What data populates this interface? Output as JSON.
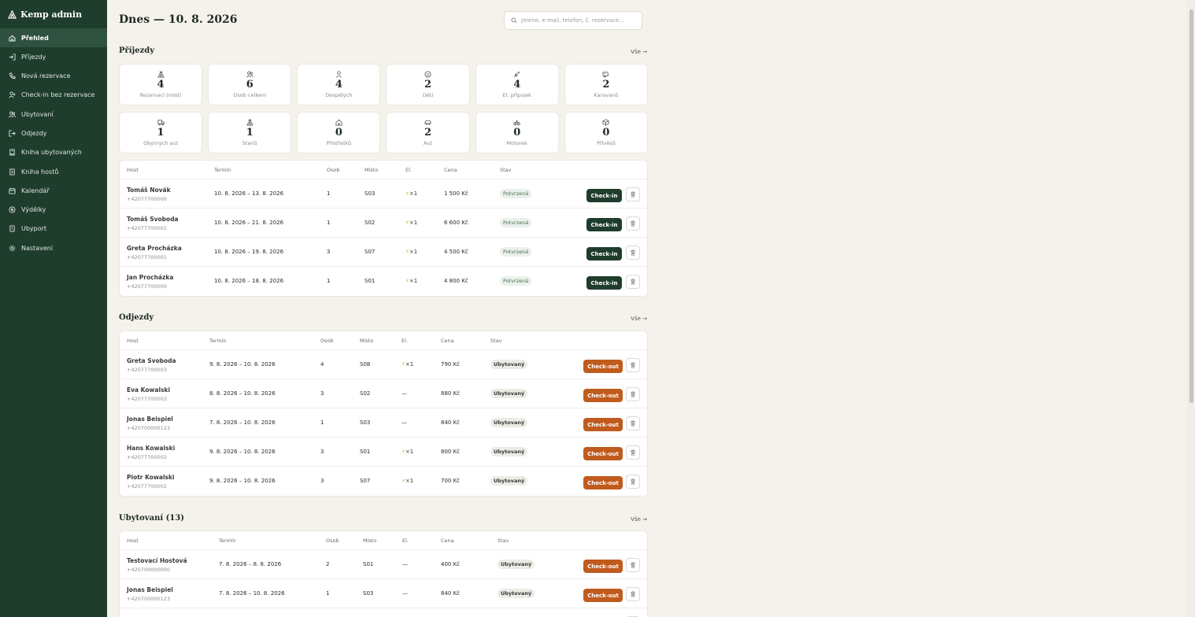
{
  "app": {
    "title": "Kemp admin"
  },
  "sidebar": {
    "items": [
      {
        "label": "Přehled",
        "icon": "home-icon",
        "active": true
      },
      {
        "label": "Příjezdy",
        "icon": "login-icon"
      },
      {
        "label": "Nová rezervace",
        "icon": "phone-icon"
      },
      {
        "label": "Check-in bez rezervace",
        "icon": "user-plus-icon"
      },
      {
        "label": "Ubytovaní",
        "icon": "users-icon"
      },
      {
        "label": "Odjezdy",
        "icon": "logout-icon"
      },
      {
        "label": "Kniha ubytovaných",
        "icon": "book-icon"
      },
      {
        "label": "Kniha hostů",
        "icon": "book-open-icon"
      },
      {
        "label": "Kalendář",
        "icon": "calendar-icon"
      },
      {
        "label": "Výdělky",
        "icon": "money-icon"
      },
      {
        "label": "Ubyport",
        "icon": "document-icon"
      },
      {
        "label": "Nastavení",
        "icon": "gear-icon"
      }
    ]
  },
  "header": {
    "title": "Dnes — 10. 8. 2026",
    "search_placeholder": "Jméno, e-mail, telefon, č. rezervace..."
  },
  "arrivals": {
    "title": "Příjezdy",
    "see_all": "Vše →",
    "stats": [
      {
        "value": "4",
        "label": "Rezervací (míst)",
        "icon": "tent-icon"
      },
      {
        "value": "6",
        "label": "Osob celkem",
        "icon": "users-icon"
      },
      {
        "value": "4",
        "label": "Dospělých",
        "icon": "person-icon"
      },
      {
        "value": "2",
        "label": "Děti",
        "icon": "child-icon"
      },
      {
        "value": "4",
        "label": "El. přípojek",
        "icon": "plug-icon"
      },
      {
        "value": "2",
        "label": "Karavanů",
        "icon": "caravan-icon"
      },
      {
        "value": "1",
        "label": "Obytných aut",
        "icon": "truck-icon"
      },
      {
        "value": "1",
        "label": "Stanů",
        "icon": "tent-icon"
      },
      {
        "value": "0",
        "label": "Přístřešků",
        "icon": "shelter-icon"
      },
      {
        "value": "2",
        "label": "Aut",
        "icon": "car-icon"
      },
      {
        "value": "0",
        "label": "Motorek",
        "icon": "bike-icon"
      },
      {
        "value": "0",
        "label": "Přívěsů",
        "icon": "box-icon"
      }
    ],
    "columns": [
      "Host",
      "Termín",
      "Osob",
      "Místo",
      "El.",
      "Cena",
      "Stav"
    ],
    "rows": [
      {
        "name": "Tomáš Novák",
        "phone": "+42077700000",
        "term": "10. 8. 2026 – 13. 8. 2026",
        "persons": "1",
        "place": "S03",
        "el": "×1",
        "price": "1 500 Kč",
        "status": "Potvrzená",
        "action": "Check-in"
      },
      {
        "name": "Tomáš Svoboda",
        "phone": "+42077700001",
        "term": "10. 8. 2026 – 21. 8. 2026",
        "persons": "1",
        "place": "S02",
        "el": "×1",
        "price": "6 600 Kč",
        "status": "Potvrzená",
        "action": "Check-in"
      },
      {
        "name": "Greta Procházka",
        "phone": "+42077700001",
        "term": "10. 8. 2026 – 19. 8. 2026",
        "persons": "3",
        "place": "S07",
        "el": "×1",
        "price": "4 500 Kč",
        "status": "Potvrzená",
        "action": "Check-in"
      },
      {
        "name": "Jan Procházka",
        "phone": "+42077700000",
        "term": "10. 8. 2026 – 18. 8. 2026",
        "persons": "1",
        "place": "S01",
        "el": "×1",
        "price": "4 800 Kč",
        "status": "Potvrzená",
        "action": "Check-in"
      }
    ]
  },
  "departures": {
    "title": "Odjezdy",
    "see_all": "Vše →",
    "columns": [
      "Host",
      "Termín",
      "Osob",
      "Místo",
      "El.",
      "Cena",
      "Stav"
    ],
    "rows": [
      {
        "name": "Greta Svoboda",
        "phone": "+42077700003",
        "term": "9. 8. 2026 – 10. 8. 2026",
        "persons": "4",
        "place": "S08",
        "el": "×1",
        "price": "790 Kč",
        "status": "Ubytovaný",
        "action": "Check-out"
      },
      {
        "name": "Eva Kowalski",
        "phone": "+42077700003",
        "term": "8. 8. 2026 – 10. 8. 2026",
        "persons": "3",
        "place": "S02",
        "el": "—",
        "price": "880 Kč",
        "status": "Ubytovaný",
        "action": "Check-out"
      },
      {
        "name": "Jonas Beispiel",
        "phone": "+420700000123",
        "term": "7. 8. 2026 – 10. 8. 2026",
        "persons": "1",
        "place": "S03",
        "el": "—",
        "price": "840 Kč",
        "status": "Ubytovaný",
        "action": "Check-out"
      },
      {
        "name": "Hans Kowalski",
        "phone": "+42077700002",
        "term": "9. 8. 2026 – 10. 8. 2026",
        "persons": "3",
        "place": "S01",
        "el": "×1",
        "price": "800 Kč",
        "status": "Ubytovaný",
        "action": "Check-out"
      },
      {
        "name": "Piotr Kowalski",
        "phone": "+42077700002",
        "term": "9. 8. 2026 – 10. 8. 2026",
        "persons": "3",
        "place": "S07",
        "el": "×1",
        "price": "700 Kč",
        "status": "Ubytovaný",
        "action": "Check-out"
      }
    ]
  },
  "staying": {
    "title": "Ubytovaní (13)",
    "see_all": "Vše →",
    "columns": [
      "Host",
      "Termín",
      "Osob",
      "Místo",
      "El.",
      "Cena",
      "Stav"
    ],
    "rows": [
      {
        "name": "Testovací Hostová",
        "phone": "+420700000000",
        "term": "7. 8. 2026 – 8. 8. 2026",
        "persons": "2",
        "place": "S01",
        "el": "—",
        "price": "400 Kč",
        "status": "Ubytovaný",
        "action": "Check-out"
      },
      {
        "name": "Jonas Beispiel",
        "phone": "+420700000123",
        "term": "7. 8. 2026 – 10. 8. 2026",
        "persons": "1",
        "place": "S03",
        "el": "—",
        "price": "840 Kč",
        "status": "Ubytovaný",
        "action": "Check-out"
      },
      {
        "name": "",
        "phone": "",
        "term": "",
        "persons": "",
        "place": "",
        "el": "",
        "price": "",
        "status": "",
        "action": ""
      }
    ]
  },
  "colors": {
    "sidebar": "#1f3d2c",
    "accent_green": "#1f3d2c",
    "accent_orange": "#c05b1e",
    "background": "#f5f2ec"
  }
}
